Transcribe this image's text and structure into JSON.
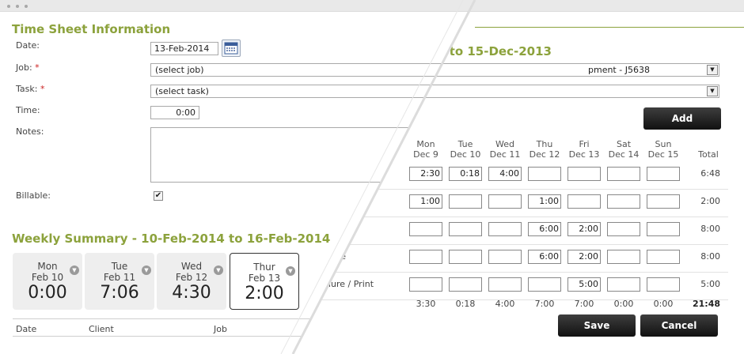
{
  "left": {
    "title": "Time Sheet Information",
    "date_label": "Date:",
    "date_value": "13-Feb-2014",
    "job_label": "Job:",
    "job_required": "*",
    "job_value": "(select job)",
    "task_label": "Task:",
    "task_required": "*",
    "task_value": "(select task)",
    "time_label": "Time:",
    "time_value": "0:00",
    "notes_label": "Notes:",
    "billable_label": "Billable:",
    "billable_checked": true,
    "weekly_title": "Weekly Summary - 10-Feb-2014 to 16-Feb-2014",
    "days": [
      {
        "day": "Mon",
        "date": "Feb 10",
        "time": "0:00"
      },
      {
        "day": "Tue",
        "date": "Feb 11",
        "time": "7:06"
      },
      {
        "day": "Wed",
        "date": "Feb 12",
        "time": "4:30"
      },
      {
        "day": "Thur",
        "date": "Feb 13",
        "time": "2:00",
        "active": true
      }
    ],
    "list_headers": [
      "Date",
      "Client",
      "Job"
    ]
  },
  "right": {
    "title_fragment": "3 to 15-Dec-2013",
    "job_fragment": "pment - J5638",
    "add_label": "Add",
    "columns": [
      {
        "day": "Mon",
        "date": "Dec 9"
      },
      {
        "day": "Tue",
        "date": "Dec 10"
      },
      {
        "day": "Wed",
        "date": "Dec 11"
      },
      {
        "day": "Thu",
        "date": "Dec 12"
      },
      {
        "day": "Fri",
        "date": "Dec 13"
      },
      {
        "day": "Sat",
        "date": "Dec 14"
      },
      {
        "day": "Sun",
        "date": "Dec 15"
      }
    ],
    "total_label": "Total",
    "rows": [
      {
        "label": "",
        "cells": [
          "2:30",
          "0:18",
          "4:00",
          "",
          "",
          "",
          ""
        ],
        "total": "6:48"
      },
      {
        "label": "",
        "cells": [
          "1:00",
          "",
          "",
          "1:00",
          "",
          "",
          ""
        ],
        "total": "2:00"
      },
      {
        "label": "",
        "cells": [
          "",
          "",
          "",
          "6:00",
          "2:00",
          "",
          ""
        ],
        "total": "8:00"
      },
      {
        "label": "re",
        "cells": [
          "",
          "",
          "",
          "6:00",
          "2:00",
          "",
          ""
        ],
        "total": "8:00"
      },
      {
        "label": "chure / Print",
        "cells": [
          "",
          "",
          "",
          "",
          "5:00",
          "",
          ""
        ],
        "total": "5:00"
      }
    ],
    "day_totals": [
      "3:30",
      "0:18",
      "4:00",
      "7:00",
      "7:00",
      "0:00",
      "0:00"
    ],
    "grand_total": "21:48",
    "save_label": "Save",
    "cancel_label": "Cancel"
  },
  "colors": {
    "title_green": "#8ca23c",
    "button_dark": "#111111",
    "accent_line": "#8ca23c"
  }
}
